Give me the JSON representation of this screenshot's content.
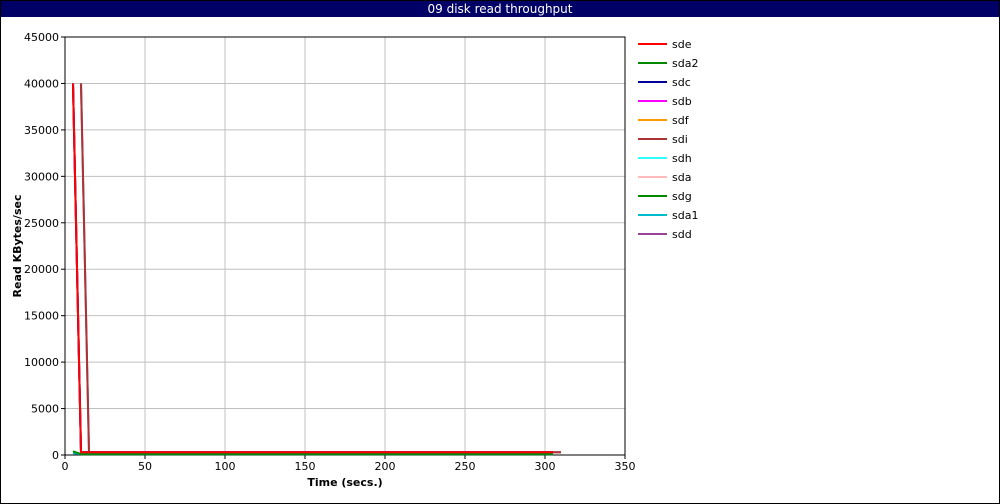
{
  "chart_data": {
    "type": "line",
    "title": "09 disk read throughput",
    "xlabel": "Time (secs.)",
    "ylabel": "Read KBytes/sec",
    "xlim": [
      0,
      350
    ],
    "ylim": [
      0,
      45000
    ],
    "xticks": [
      0,
      50,
      100,
      150,
      200,
      250,
      300,
      350
    ],
    "yticks": [
      0,
      5000,
      10000,
      15000,
      20000,
      25000,
      30000,
      35000,
      40000,
      45000
    ],
    "grid": true,
    "legend_position": "right",
    "series": [
      {
        "name": "sde",
        "color": "#ff0000",
        "points": [
          [
            5,
            40000
          ],
          [
            10,
            300
          ],
          [
            305,
            300
          ]
        ]
      },
      {
        "name": "sda2",
        "color": "#008800",
        "points": [
          [
            5,
            400
          ],
          [
            10,
            100
          ],
          [
            305,
            100
          ]
        ]
      },
      {
        "name": "sdc",
        "color": "#000099",
        "points": [
          [
            5,
            40000
          ],
          [
            10,
            300
          ],
          [
            305,
            300
          ]
        ]
      },
      {
        "name": "sdb",
        "color": "#ff00ff",
        "points": [
          [
            5,
            40000
          ],
          [
            10,
            300
          ],
          [
            305,
            300
          ]
        ]
      },
      {
        "name": "sdf",
        "color": "#ff9900",
        "points": [
          [
            5,
            40000
          ],
          [
            10,
            300
          ],
          [
            305,
            300
          ]
        ]
      },
      {
        "name": "sdi",
        "color": "#aa3333",
        "points": [
          [
            10,
            40000
          ],
          [
            15,
            300
          ],
          [
            310,
            300
          ]
        ]
      },
      {
        "name": "sdh",
        "color": "#33ffff",
        "points": [
          [
            5,
            40000
          ],
          [
            10,
            300
          ],
          [
            305,
            300
          ]
        ]
      },
      {
        "name": "sda",
        "color": "#ffbbbb",
        "points": [
          [
            5,
            40000
          ],
          [
            10,
            300
          ],
          [
            305,
            300
          ]
        ]
      },
      {
        "name": "sdg",
        "color": "#008800",
        "points": [
          [
            5,
            40000
          ],
          [
            10,
            300
          ],
          [
            305,
            300
          ]
        ]
      },
      {
        "name": "sda1",
        "color": "#00bbcc",
        "points": [
          [
            5,
            200
          ],
          [
            10,
            100
          ],
          [
            305,
            100
          ]
        ]
      },
      {
        "name": "sdd",
        "color": "#994499",
        "points": [
          [
            10,
            40000
          ],
          [
            15,
            300
          ],
          [
            310,
            300
          ]
        ]
      }
    ]
  }
}
